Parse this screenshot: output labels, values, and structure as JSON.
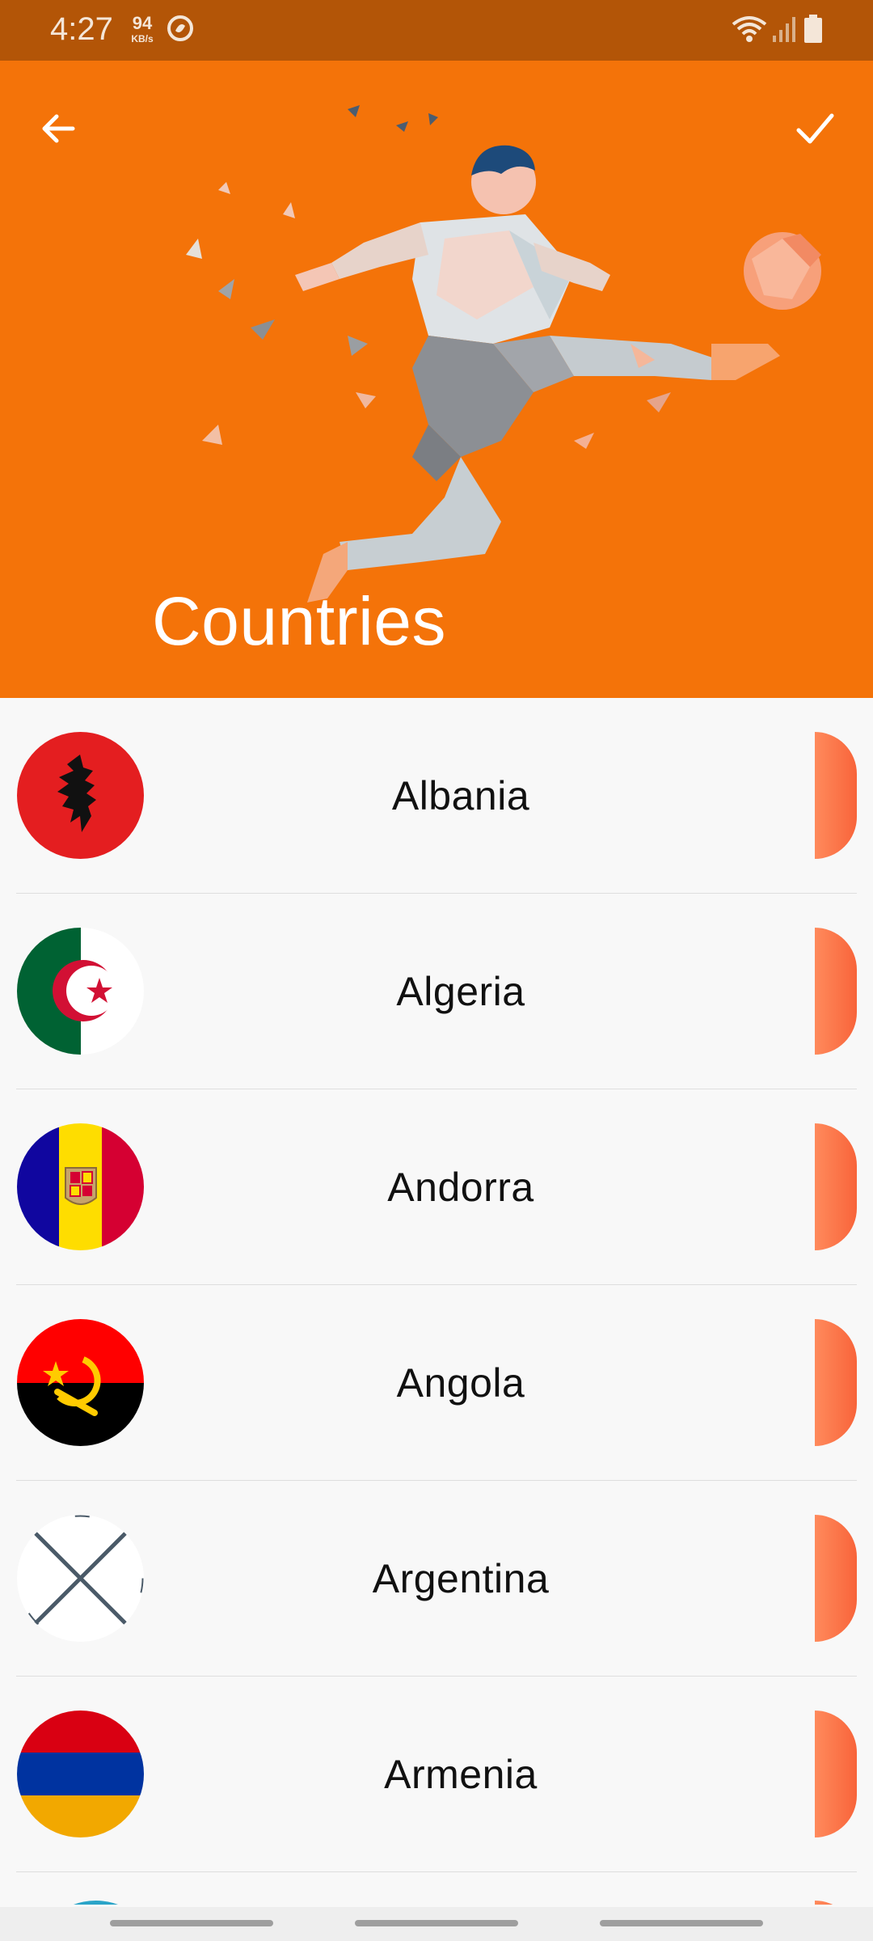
{
  "status_bar": {
    "time": "4:27",
    "net_speed_value": "94",
    "net_speed_unit": "KB/s",
    "icons": [
      "app-notification-icon",
      "wifi-icon",
      "signal-icon",
      "battery-icon"
    ]
  },
  "header": {
    "title": "Countries",
    "background_color": "#f47309",
    "back_icon": "arrow-left-icon",
    "confirm_icon": "checkmark-icon",
    "illustration": "low-poly-soccer-player"
  },
  "countries": [
    {
      "name": "Albania"
    },
    {
      "name": "Algeria"
    },
    {
      "name": "Andorra"
    },
    {
      "name": "Angola"
    },
    {
      "name": "Argentina"
    },
    {
      "name": "Armenia"
    }
  ],
  "colors": {
    "accent": "#f47309",
    "status_bar": "#b35507",
    "tab_start": "#ff8a5c",
    "tab_end": "#f8643a"
  }
}
